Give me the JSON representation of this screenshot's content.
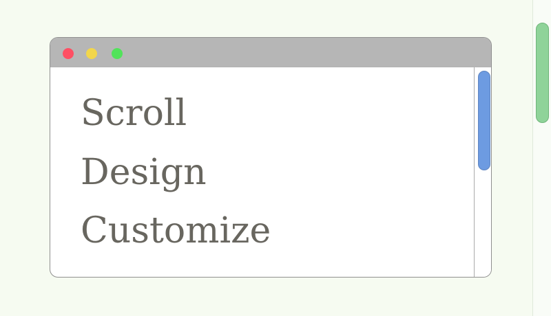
{
  "window": {
    "items": [
      "Scroll",
      "Design",
      "Customize"
    ]
  },
  "colors": {
    "page_background": "#f6fbf1",
    "titlebar": "#b6b6b6",
    "close_dot": "#ff4f63",
    "minimize_dot": "#f2d64b",
    "maximize_dot": "#51e35a",
    "text": "#68665f",
    "inner_scroll_thumb": "#6d9be1",
    "outer_scroll_thumb": "#8fd399"
  },
  "icons": {
    "close": "red-dot-icon",
    "minimize": "yellow-dot-icon",
    "maximize": "green-dot-icon"
  }
}
